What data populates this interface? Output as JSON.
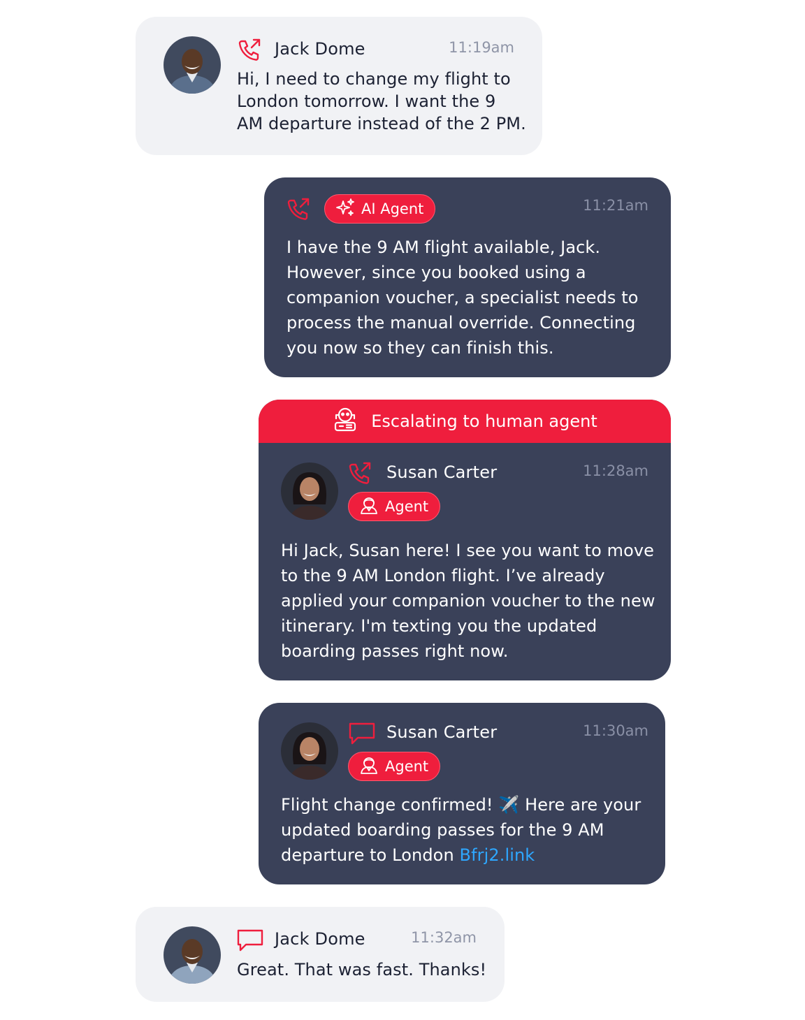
{
  "messages": [
    {
      "sender": "Jack Dome",
      "time": "11:19am",
      "channel": "phone-icon",
      "text": "Hi, I need to change my flight to London tomorrow. I want the 9 AM departure instead of the 2 PM.",
      "lines": [
        "Hi, I need to change my flight to",
        "London tomorrow. I want the 9",
        "AM departure instead of the 2 PM."
      ]
    },
    {
      "badge": "AI Agent",
      "time": "11:21am",
      "channel": "phone-icon",
      "lines": [
        "I have the 9 AM flight available, Jack.",
        "However, since you booked using a",
        "companion voucher, a specialist needs to",
        "process the manual override. Connecting",
        "you now so they can finish this."
      ]
    },
    {
      "banner": "Escalating to human agent",
      "sender": "Susan Carter",
      "badge": "Agent",
      "time": "11:28am",
      "channel": "phone-icon",
      "lines": [
        "Hi Jack, Susan here! I see you want to move",
        "to the 9 AM London flight. I’ve already",
        "applied your companion voucher to the new",
        "itinerary. I'm texting you the updated",
        "boarding passes right now."
      ]
    },
    {
      "sender": "Susan Carter",
      "badge": "Agent",
      "time": "11:30am",
      "channel": "chat-icon",
      "lines": [
        "Flight change confirmed! ✈️ Here are your",
        "updated boarding passes for the 9 AM",
        "departure to London"
      ],
      "link": "Bfrj2.link"
    },
    {
      "sender": "Jack Dome",
      "time": "11:32am",
      "channel": "chat-icon",
      "lines": [
        "Great. That was fast. Thanks!"
      ]
    }
  ],
  "colors": {
    "accent": "#ef1e3d",
    "dark_card": "#3a4159",
    "light_card": "#f1f2f5",
    "link": "#2ea7ff"
  }
}
